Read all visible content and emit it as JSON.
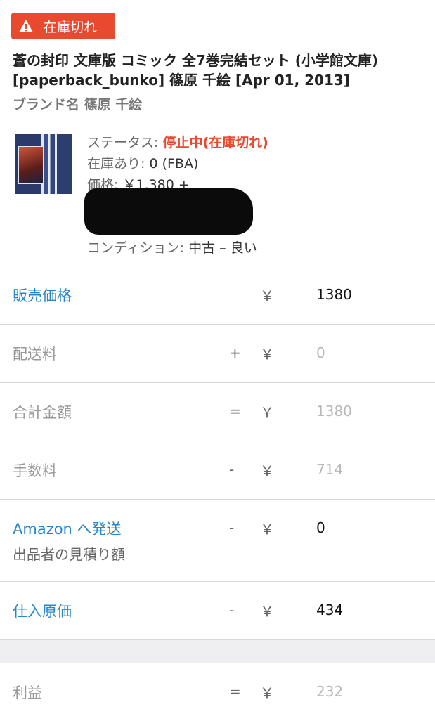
{
  "status_badge": {
    "label": "在庫切れ",
    "color": "#e8492f",
    "icon": "warning-icon"
  },
  "product": {
    "title": "蒼の封印 文庫版 コミック 全7巻完結セット (小学館文庫) [paperback_bunko] 篠原 千絵 [Apr 01, 2013]",
    "brand": "ブランド名 篠原 千絵"
  },
  "info": {
    "status_label": "ステータス: ",
    "status_value": "停止中(在庫切れ)",
    "stock_label": "在庫あり: ",
    "stock_value": "0 (FBA)",
    "price_label": "価格: ",
    "price_value": "￥1,380 +",
    "condition_label": "コンディション: ",
    "condition_value": "中古 – 良い"
  },
  "rows": [
    {
      "label": "販売価格",
      "op": "",
      "yen": "￥",
      "amount": "1380"
    },
    {
      "label": "配送料",
      "op": "+",
      "yen": "￥",
      "amount": "0"
    },
    {
      "label": "合計金額",
      "op": "=",
      "yen": "￥",
      "amount": "1380"
    },
    {
      "label": "手数料",
      "op": "-",
      "yen": "￥",
      "amount": "714"
    },
    {
      "label": "Amazon へ発送",
      "sub": "出品者の見積り額",
      "op": "-",
      "yen": "￥",
      "amount": "0"
    },
    {
      "label": "仕入原価",
      "op": "-",
      "yen": "￥",
      "amount": "434"
    },
    {
      "label": "利益",
      "op": "=",
      "yen": "￥",
      "amount": "232"
    }
  ],
  "colors": {
    "link": "#2a87c7",
    "alert": "#e8492f",
    "muted": "#b8b8b8"
  }
}
